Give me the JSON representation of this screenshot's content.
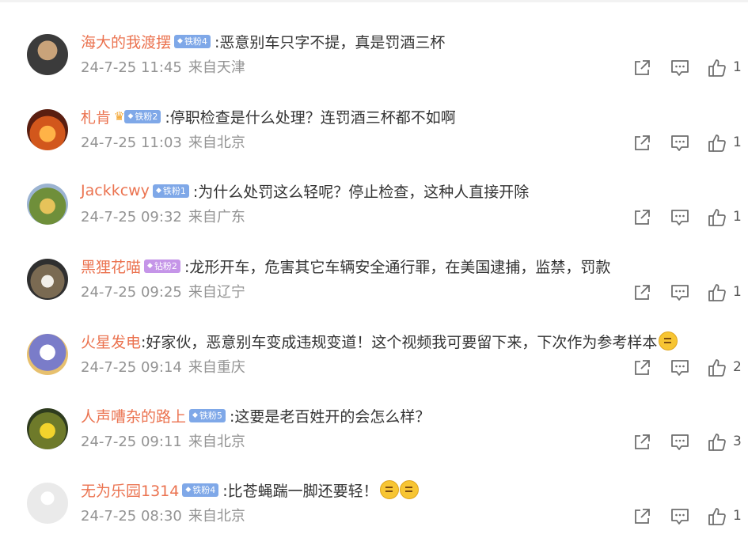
{
  "badge_colors": {
    "tiefen": "#7fa8e8",
    "zuanfen": "#c595e8"
  },
  "icons": {
    "share": "share-icon",
    "comment": "comment-icon",
    "like": "thumbs-up-icon"
  },
  "comments": [
    {
      "user": "海大的我渡摆",
      "badge": "铁粉4",
      "badge_type": "tiefen",
      "crown": false,
      "text": ":恶意别车只字不提，真是罚酒三杯",
      "time": "24-7-25 11:45",
      "source": "来自天津",
      "likes": "1",
      "emoji": 0
    },
    {
      "user": "札肯",
      "badge": "铁粉2",
      "badge_type": "tiefen",
      "crown": true,
      "text": ":停职检查是什么处理？连罚酒三杯都不如啊",
      "time": "24-7-25 11:03",
      "source": "来自北京",
      "likes": "1",
      "emoji": 0
    },
    {
      "user": "Jackkcwy",
      "badge": "铁粉1",
      "badge_type": "tiefen",
      "crown": false,
      "text": ":为什么处罚这么轻呢？停止检查，这种人直接开除",
      "time": "24-7-25 09:32",
      "source": "来自广东",
      "likes": "1",
      "emoji": 0
    },
    {
      "user": "黑狸花喵",
      "badge": "钻粉2",
      "badge_type": "zuanfen",
      "crown": false,
      "text": ":龙形开车，危害其它车辆安全通行罪，在美国逮捕，监禁，罚款",
      "time": "24-7-25 09:25",
      "source": "来自辽宁",
      "likes": "1",
      "emoji": 0
    },
    {
      "user": "火星发电",
      "badge": "",
      "badge_type": "",
      "crown": false,
      "text": ":好家伙，恶意别车变成违规变道！这个视频我可要留下来，下次作为参考样本",
      "time": "24-7-25 09:14",
      "source": "来自重庆",
      "likes": "2",
      "emoji": 1
    },
    {
      "user": "人声嘈杂的路上",
      "badge": "铁粉5",
      "badge_type": "tiefen",
      "crown": false,
      "text": ":这要是老百姓开的会怎么样？",
      "time": "24-7-25 09:11",
      "source": "来自北京",
      "likes": "3",
      "emoji": 0
    },
    {
      "user": "无为乐园1314",
      "badge": "铁粉4",
      "badge_type": "tiefen",
      "crown": false,
      "text": ":比苍蝇踹一脚还要轻！",
      "time": "24-7-25 08:30",
      "source": "来自北京",
      "likes": "1",
      "emoji": 2
    }
  ]
}
